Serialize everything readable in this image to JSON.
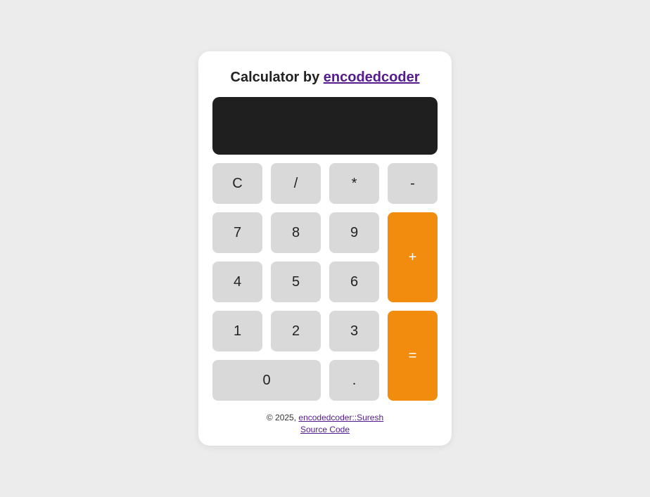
{
  "title": {
    "prefix": "Calculator by ",
    "link_text": "encodedcoder"
  },
  "display": {
    "value": ""
  },
  "buttons": {
    "clear": "C",
    "divide": "/",
    "multiply": "*",
    "subtract": "-",
    "seven": "7",
    "eight": "8",
    "nine": "9",
    "add": "+",
    "four": "4",
    "five": "5",
    "six": "6",
    "one": "1",
    "two": "2",
    "three": "3",
    "equals": "=",
    "zero": "0",
    "decimal": "."
  },
  "footer": {
    "copyright": "© 2025, ",
    "author_link": "encodedcoder::Suresh",
    "source_link": "Source Code"
  }
}
